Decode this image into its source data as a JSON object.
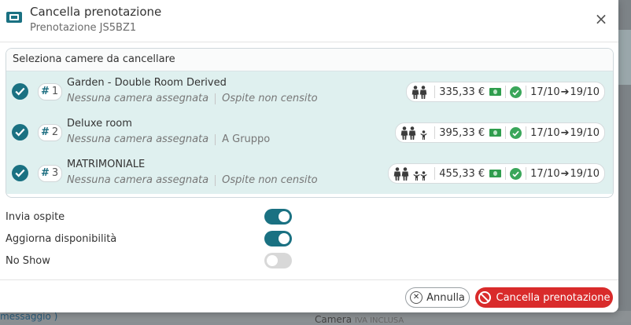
{
  "dialog": {
    "title": "Cancella prenotazione",
    "subtitle": "Prenotazione JS5BZ1",
    "close_icon": "close-icon"
  },
  "panel": {
    "heading": "Seleziona camere da cancellare",
    "rooms": [
      {
        "index": "1",
        "name": "Garden - Double Room Derived",
        "assignment": "Nessuna camera assegnata",
        "guest": "Ospite non censito",
        "adults": 2,
        "children": 0,
        "price": "335,33 €",
        "dates": "17/10",
        "dates_end": "19/10",
        "selected": true
      },
      {
        "index": "2",
        "name": "Deluxe room",
        "assignment": "Nessuna camera assegnata",
        "guest": "A Gruppo",
        "adults": 2,
        "children": 1,
        "price": "395,33 €",
        "dates": "17/10",
        "dates_end": "19/10",
        "selected": true
      },
      {
        "index": "3",
        "name": "MATRIMONIALE",
        "assignment": "Nessuna camera assegnata",
        "guest": "Ospite non censito",
        "adults": 2,
        "children": 2,
        "price": "455,33 €",
        "dates": "17/10",
        "dates_end": "19/10",
        "selected": true
      }
    ]
  },
  "options": [
    {
      "label": "Invia ospite",
      "on": true
    },
    {
      "label": "Aggiorna disponibilità",
      "on": true
    },
    {
      "label": "No Show",
      "on": false
    }
  ],
  "footer": {
    "cancel_label": "Annulla",
    "delete_label": "Cancella prenotazione"
  },
  "background": {
    "left_text": "messaggio )",
    "right_text": "Camera",
    "right_small": "IVA INCLUSA"
  },
  "colors": {
    "accent": "#1a7182",
    "row_bg": "#dff0ef",
    "danger": "#d92b2b",
    "ok": "#3aa65a"
  }
}
